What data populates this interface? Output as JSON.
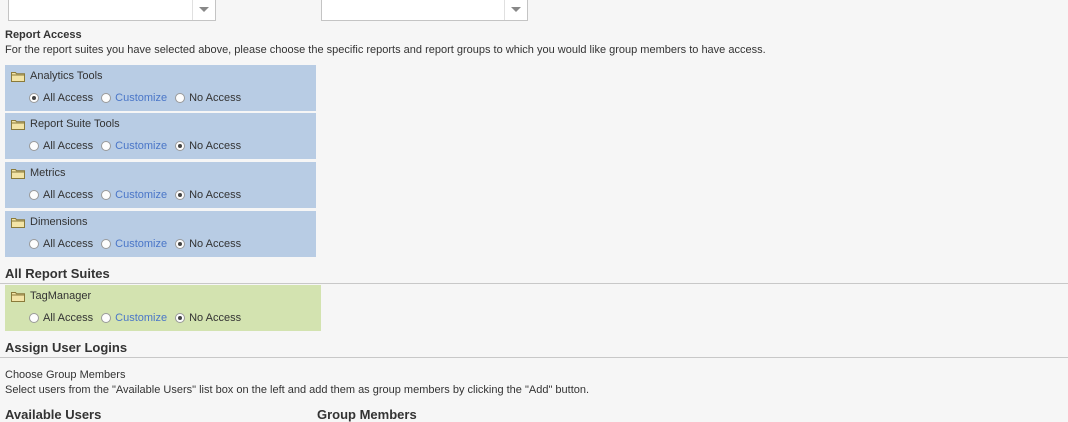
{
  "report_access": {
    "heading": "Report Access",
    "description": "For the report suites you have selected above, please choose the specific reports and report groups to which you would like group members to have access.",
    "options": [
      "All Access",
      "Customize",
      "No Access"
    ],
    "groups": [
      {
        "name": "Analytics Tools",
        "selected": "All Access"
      },
      {
        "name": "Report Suite Tools",
        "selected": "No Access"
      },
      {
        "name": "Metrics",
        "selected": "No Access"
      },
      {
        "name": "Dimensions",
        "selected": "No Access"
      }
    ]
  },
  "all_report_suites": {
    "title": "All Report Suites",
    "groups": [
      {
        "name": "TagManager",
        "selected": "No Access"
      }
    ]
  },
  "assign_user_logins": {
    "title": "Assign User Logins",
    "subheading": "Choose Group Members",
    "description": "Select users from the \"Available Users\" list box on the left and add them as group members by clicking the \"Add\" button.",
    "available_users_label": "Available Users",
    "group_members_label": "Group Members"
  },
  "colors": {
    "group_blue": "#b8cce4",
    "group_green": "#d3e3b0",
    "link": "#4a76c8"
  }
}
